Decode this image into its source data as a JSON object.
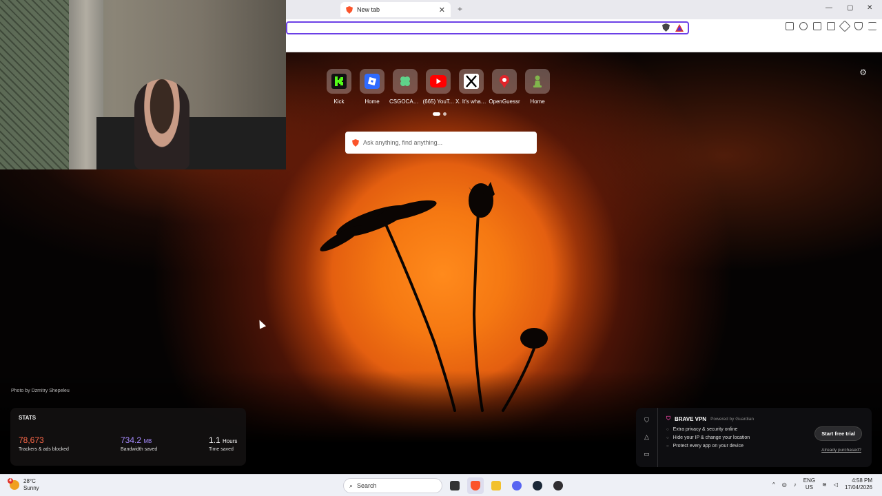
{
  "browser": {
    "tab_title": "New tab",
    "newtab_symbol": "+",
    "close_symbol": "✕",
    "win_minimize": "—",
    "win_maximize": "▢",
    "win_close": "✕"
  },
  "ntp": {
    "tiles": [
      {
        "label": "Kick",
        "icon": "kick-icon",
        "color": "#53fc18"
      },
      {
        "label": "Home",
        "icon": "roblox-icon",
        "color": "#2f6bff"
      },
      {
        "label": "CSGOCASE...",
        "icon": "clover-icon",
        "color": "#5fd38a"
      },
      {
        "label": "(665) YouT...",
        "icon": "youtube-icon",
        "color": "#ff0000"
      },
      {
        "label": "X. It's what'...",
        "icon": "x-icon",
        "color": "#000000"
      },
      {
        "label": "OpenGuessr",
        "icon": "pin-icon",
        "color": "#e0242a"
      },
      {
        "label": "Home",
        "icon": "chess-icon",
        "color": "#81b64c"
      }
    ],
    "search_placeholder": "Ask anything, find anything...",
    "photo_credit": "Photo by Dzmitry Shepeleu",
    "settings_symbol": "⚙"
  },
  "stats": {
    "title": "STATS",
    "trackers_value": "78,673",
    "trackers_caption": "Trackers & ads blocked",
    "trackers_color": "#ff6a4a",
    "bandwidth_value": "734.2",
    "bandwidth_unit": "MB",
    "bandwidth_caption": "Bandwidth saved",
    "bandwidth_color": "#a78cff",
    "time_value": "1.1",
    "time_unit": "Hours",
    "time_caption": "Time saved"
  },
  "vpn": {
    "title": "BRAVE VPN",
    "powered_by": "Powered by  Guardian",
    "features": [
      "Extra privacy & security online",
      "Hide your IP & change your location",
      "Protect every app on your device"
    ],
    "button": "Start free trial",
    "link": "Already purchased?"
  },
  "taskbar": {
    "temp": "28°C",
    "condition": "Sunny",
    "weather_badge": "4",
    "search_label": "Search",
    "lang_1": "ENG",
    "lang_2": "US",
    "time": "4:58 PM",
    "date": "17/04/2026",
    "tray_up": "^"
  }
}
